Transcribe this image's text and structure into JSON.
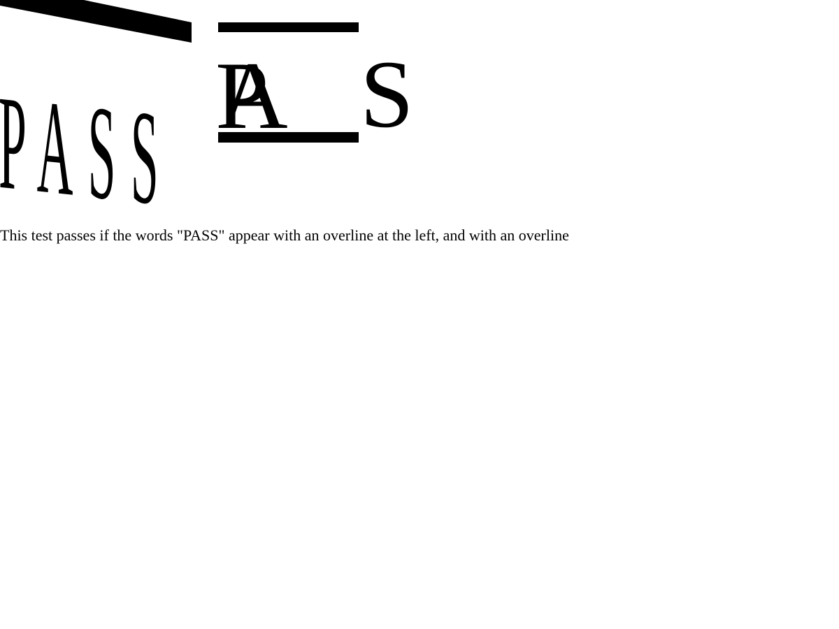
{
  "test": {
    "left_word": "PASS",
    "right_letters": [
      "P",
      "A",
      "S"
    ],
    "description": "This test passes if the words \"PASS\" appear with an overline at the left, and with an overline"
  },
  "colors": {
    "ink": "#000000",
    "background": "#ffffff"
  }
}
